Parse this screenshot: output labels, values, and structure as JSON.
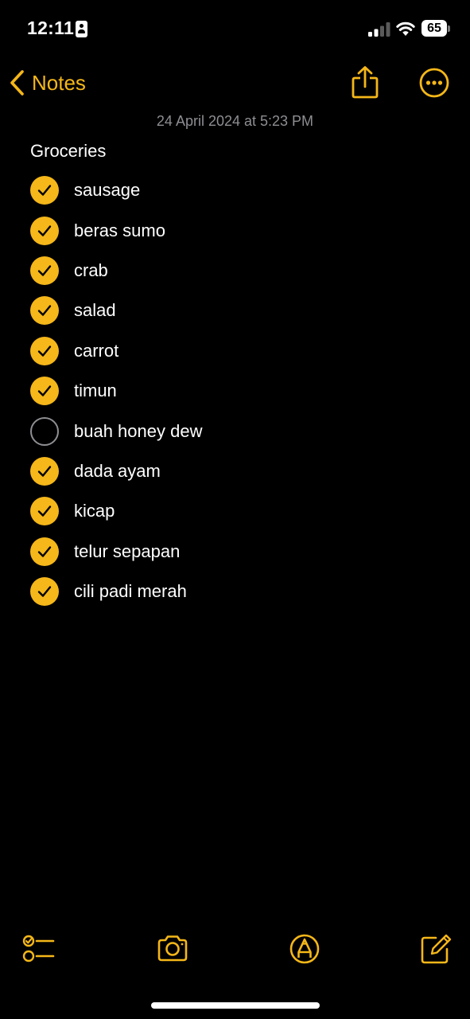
{
  "status_bar": {
    "time": "12:11",
    "battery_level": "65"
  },
  "nav": {
    "back_label": "Notes",
    "share_icon": "share-icon",
    "more_icon": "ellipsis-circle-icon"
  },
  "note": {
    "date": "24 April 2024 at 5:23 PM",
    "title": "Groceries",
    "items": [
      {
        "label": "sausage",
        "checked": true
      },
      {
        "label": "beras sumo",
        "checked": true
      },
      {
        "label": "crab",
        "checked": true
      },
      {
        "label": "salad",
        "checked": true
      },
      {
        "label": "carrot",
        "checked": true
      },
      {
        "label": "timun",
        "checked": true
      },
      {
        "label": "buah honey dew",
        "checked": false
      },
      {
        "label": "dada ayam",
        "checked": true
      },
      {
        "label": "kicap",
        "checked": true
      },
      {
        "label": "telur sepapan",
        "checked": true
      },
      {
        "label": "cili padi merah",
        "checked": true
      }
    ]
  },
  "toolbar": {
    "checklist_icon": "checklist-icon",
    "camera_icon": "camera-icon",
    "markup_icon": "markup-pen-icon",
    "compose_icon": "compose-icon"
  },
  "colors": {
    "accent": "#f5b719",
    "background": "#000000",
    "secondary_text": "#8e8e93"
  }
}
